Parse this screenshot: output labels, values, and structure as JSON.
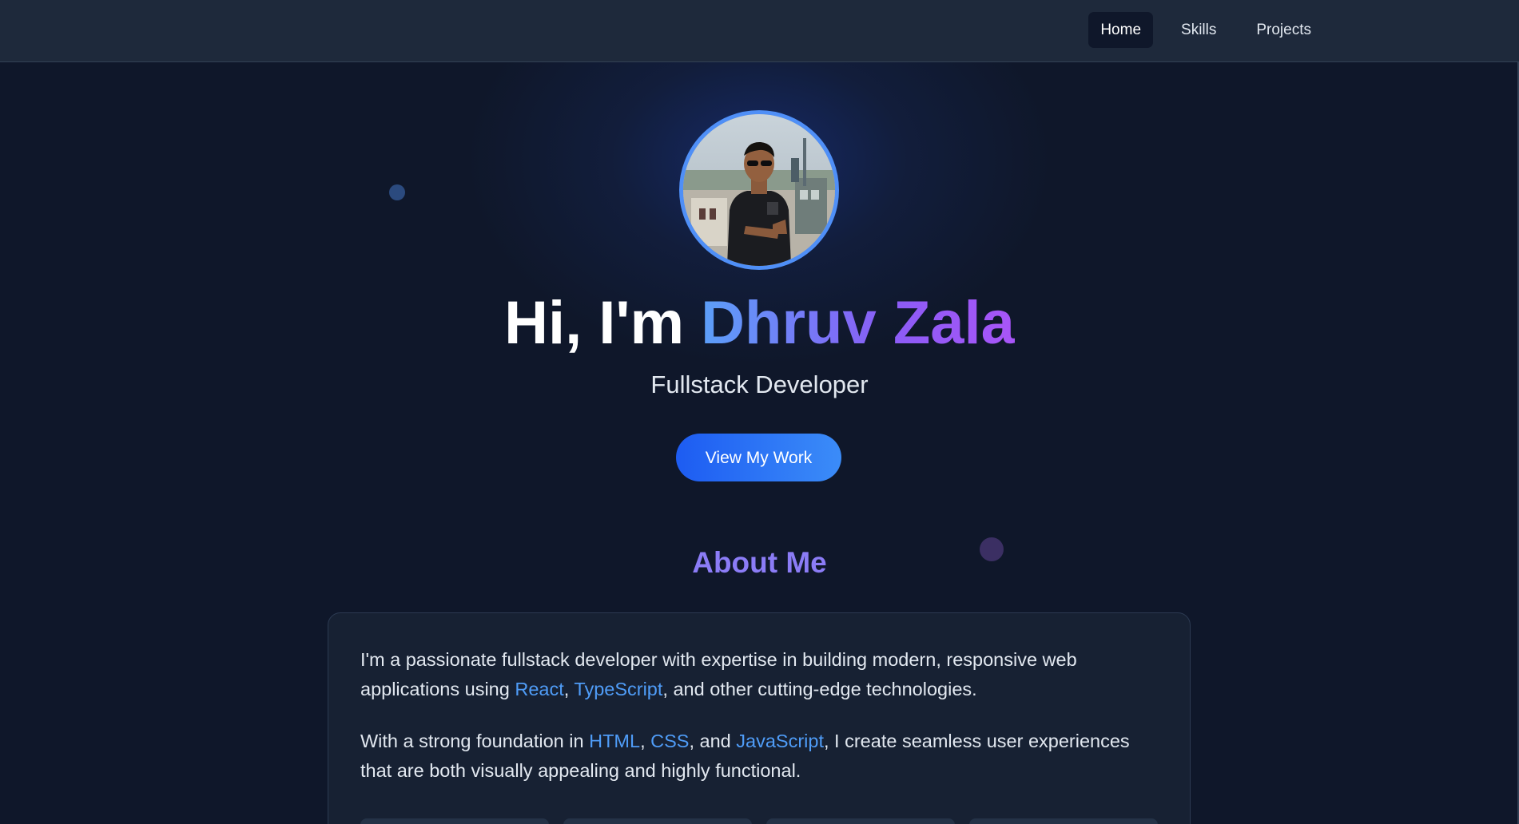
{
  "nav": {
    "items": [
      {
        "label": "Home",
        "active": true
      },
      {
        "label": "Skills",
        "active": false
      },
      {
        "label": "Projects",
        "active": false
      }
    ]
  },
  "hero": {
    "greeting": "Hi, I'm ",
    "name": "Dhruv Zala",
    "subtitle": "Fullstack Developer",
    "cta_label": "View My Work"
  },
  "about": {
    "title": "About Me",
    "p1_start": "I'm a passionate fullstack developer with expertise in building modern, responsive web applications using ",
    "p1_tech1": "React",
    "p1_sep1": ", ",
    "p1_tech2": "TypeScript",
    "p1_end": ", and other cutting-edge technologies.",
    "p2_start": "With a strong foundation in ",
    "p2_tech1": "HTML",
    "p2_sep1": ", ",
    "p2_tech2": "CSS",
    "p2_sep2": ", and ",
    "p2_tech3": "JavaScript",
    "p2_end": ", I create seamless user experiences that are both visually appealing and highly functional."
  },
  "colors": {
    "background": "#0f172a",
    "navbar": "#1e293b",
    "accent_blue": "#4f9cf7",
    "accent_purple": "#8b5cf6",
    "cta_start": "#1d5cf2",
    "cta_end": "#3b8cf8"
  }
}
